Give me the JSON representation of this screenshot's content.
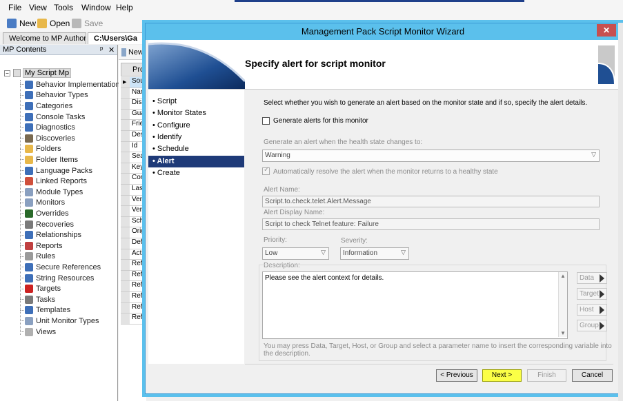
{
  "menu": [
    "File",
    "View",
    "Tools",
    "Window",
    "Help"
  ],
  "toolbar": {
    "new_label": "New",
    "open_label": "Open",
    "save_label": "Save"
  },
  "tabs": [
    {
      "label": "Welcome to MP Author!"
    },
    {
      "label": "C:\\Users\\Ga"
    }
  ],
  "left_pane": {
    "title": "MP Contents",
    "pin": "ᵖ",
    "close": "✕",
    "root": "My Script Mp",
    "items": [
      "Behavior Implementation",
      "Behavior Types",
      "Categories",
      "Console Tasks",
      "Diagnostics",
      "Discoveries",
      "Folders",
      "Folder Items",
      "Language Packs",
      "Linked Reports",
      "Module Types",
      "Monitors",
      "Overrides",
      "Recoveries",
      "Relationships",
      "Reports",
      "Rules",
      "Secure References",
      "String Resources",
      "Targets",
      "Tasks",
      "Templates",
      "Unit Monitor Types",
      "Views"
    ]
  },
  "mid_pane": {
    "new_label": "New",
    "header": "Pro",
    "rows": [
      "Sou",
      "Nam",
      "Disp",
      "Gua",
      "Frie",
      "Des",
      "Id",
      "Sea",
      "Key",
      "Con",
      "Last",
      "Vers",
      "Vers",
      "Sch",
      "Orig",
      "Defa",
      "Acti",
      "Refe",
      "Refe",
      "Refe",
      "Refe",
      "Refe",
      "Refe"
    ]
  },
  "dialog": {
    "title": "Management Pack Script Monitor Wizard",
    "close": "✕",
    "heading": "Specify alert for script monitor",
    "steps": [
      {
        "label": "• Script",
        "active": false
      },
      {
        "label": "• Monitor States",
        "active": false
      },
      {
        "label": "• Configure",
        "active": false
      },
      {
        "label": "• Identify",
        "active": false
      },
      {
        "label": "• Schedule",
        "active": false
      },
      {
        "label": "• Alert",
        "active": true
      },
      {
        "label": "• Create",
        "active": false
      }
    ],
    "instruction": "Select whether you wish to generate an alert based on the monitor state and if so, specify the alert details.",
    "generate_alerts_label": "Generate alerts for this monitor",
    "health_state_label": "Generate an alert when the health state changes to:",
    "health_state_value": "Warning",
    "auto_resolve_label": "Automatically resolve the alert when the monitor returns to a healthy state",
    "alert_name_label": "Alert Name:",
    "alert_name_value": "Script.to.check.telet.Alert.Message",
    "alert_display_label": "Alert Display Name:",
    "alert_display_value": "Script to check Telnet feature: Failure",
    "priority_label": "Priority:",
    "priority_value": "Low",
    "severity_label": "Severity:",
    "severity_value": "Information",
    "description_label": "Description:",
    "description_value": "Please see the alert context for details.",
    "side_buttons": [
      "Data",
      "Target",
      "Host",
      "Group"
    ],
    "hint_line1": "You may press Data, Target, Host, or Group and select a parameter name to insert the corresponding variable into",
    "hint_line2": "the description.",
    "buttons": {
      "previous": "< Previous",
      "next": "Next >",
      "finish": "Finish",
      "cancel": "Cancel"
    }
  },
  "colors": {
    "title_bar": "#5bc0ec",
    "active_step": "#1e3a78",
    "next_highlight": "#fbff46"
  }
}
